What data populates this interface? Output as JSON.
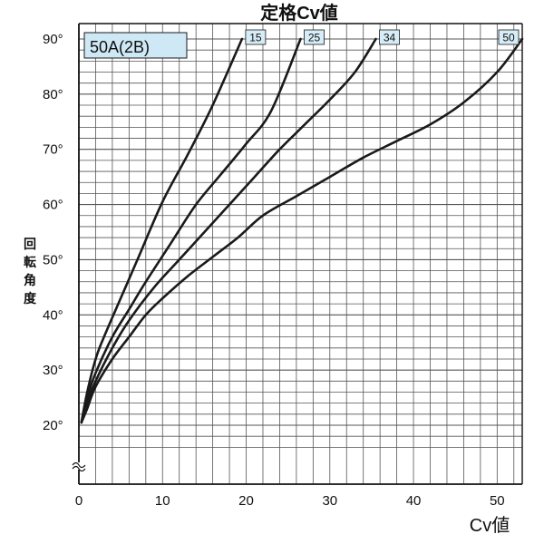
{
  "chart_data": {
    "type": "line",
    "title": "定格Cv値",
    "xlabel": "Cv値",
    "ylabel": "回転角度",
    "xlim": [
      0,
      53
    ],
    "ylim": [
      15,
      91
    ],
    "x_ticks": [
      0,
      10,
      20,
      30,
      40,
      50
    ],
    "x_tick_labels": [
      "0",
      "10",
      "20",
      "30",
      "40",
      "50"
    ],
    "y_ticks": [
      20,
      30,
      40,
      50,
      60,
      70,
      80,
      90
    ],
    "y_tick_labels": [
      "20°",
      "30°",
      "40°",
      "50°",
      "60°",
      "70°",
      "80°",
      "90°"
    ],
    "grid": true,
    "axis_break": "y",
    "size_label": "50A(2B)",
    "colors": {
      "line": "#1a1a1a",
      "grid": "#555555",
      "badge_fill": "#cfe8f5",
      "label_box_fill": "#d6ecf7"
    },
    "series": [
      {
        "name": "15",
        "x": [
          0.3,
          1,
          2,
          3,
          5,
          7,
          10,
          13,
          16,
          19.5
        ],
        "y": [
          20.5,
          26,
          32,
          36,
          43,
          50,
          60.5,
          69,
          78,
          90
        ]
      },
      {
        "name": "25",
        "x": [
          0.3,
          1,
          2,
          4,
          6,
          8,
          11,
          14,
          17,
          20,
          23,
          26.5
        ],
        "y": [
          20.5,
          25,
          29.5,
          36,
          41,
          46,
          53,
          60,
          65.5,
          71,
          77,
          90
        ]
      },
      {
        "name": "34",
        "x": [
          0.3,
          1,
          2,
          4,
          6,
          9,
          12,
          15,
          18,
          21,
          24,
          27,
          30,
          33,
          35.5
        ],
        "y": [
          20.5,
          24,
          28,
          34,
          39,
          45,
          50,
          55,
          60,
          65,
          70,
          74.5,
          79,
          84,
          90
        ]
      },
      {
        "name": "50",
        "x": [
          0.3,
          1,
          2,
          4,
          6,
          8,
          10,
          13,
          16,
          19,
          22,
          26,
          30,
          34,
          38,
          42,
          46,
          50,
          53
        ],
        "y": [
          20.5,
          23,
          27,
          32,
          36,
          40,
          43,
          47,
          50.5,
          54,
          58,
          61.5,
          65,
          68.5,
          71.5,
          74.5,
          78.5,
          84,
          90
        ]
      }
    ]
  }
}
